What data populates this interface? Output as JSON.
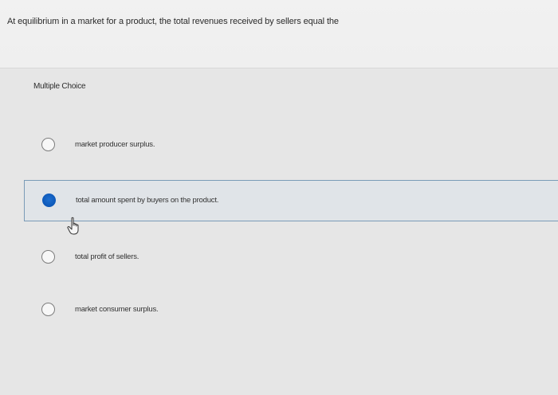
{
  "question": {
    "text": "At equilibrium in a market for a product, the total revenues received by sellers equal the"
  },
  "mc_label": "Multiple Choice",
  "options": [
    {
      "label": "market producer surplus.",
      "selected": false
    },
    {
      "label": "total amount spent by buyers on the product.",
      "selected": true
    },
    {
      "label": "total profit of sellers.",
      "selected": false
    },
    {
      "label": "market consumer surplus.",
      "selected": false
    }
  ],
  "colors": {
    "selected_radio": "#1260c4",
    "selected_border": "#7a9bb7"
  },
  "icons": {
    "cursor": "hand-pointer-icon"
  }
}
